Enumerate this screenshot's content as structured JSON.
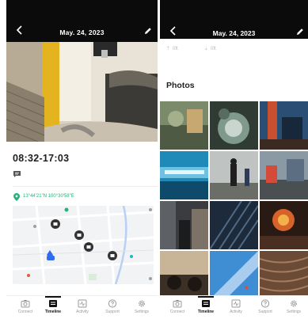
{
  "left": {
    "header": {
      "title": "May. 24, 2023"
    },
    "time_range": "08:32-17:03",
    "coordinates": "13°44'21\"N 100°30'58\"E"
  },
  "right": {
    "header": {
      "title": "May. 24, 2023"
    },
    "stats": [
      "0ft",
      "0ft"
    ],
    "photos_title": "Photos"
  },
  "tabbar": {
    "items": [
      {
        "label": "Connect",
        "icon": "camera-icon"
      },
      {
        "label": "Timeline",
        "icon": "timeline-icon",
        "active": true
      },
      {
        "label": "Activity",
        "icon": "activity-icon"
      },
      {
        "label": "Support",
        "icon": "help-icon"
      },
      {
        "label": "Settings",
        "icon": "gear-icon"
      }
    ]
  },
  "colors": {
    "accent_green": "#2bb07a",
    "header_bg": "#0b0b0b",
    "active_tab": "#111111"
  }
}
